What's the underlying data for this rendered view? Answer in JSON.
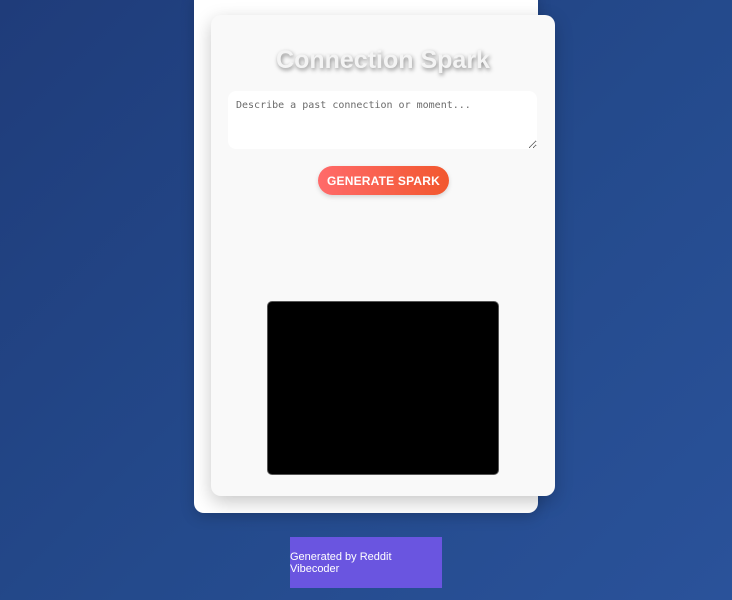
{
  "app": {
    "title": "Connection Spark"
  },
  "prompt": {
    "placeholder": "Describe a past connection or moment...",
    "value": ""
  },
  "actions": {
    "generate_label": "GENERATE SPARK"
  },
  "footer": {
    "credit": "Generated by Reddit Vibecoder"
  },
  "colors": {
    "background": "#244a8c",
    "card": "#f9f9f9",
    "button_start": "#ff6a6a",
    "button_end": "#f2582e",
    "canvas": "#000000",
    "footer_badge": "#6a55e0"
  }
}
